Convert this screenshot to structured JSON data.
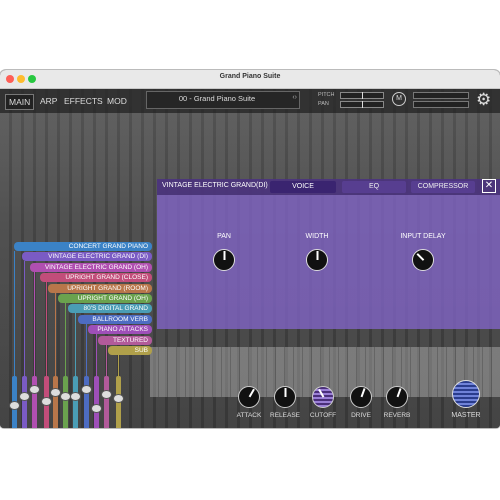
{
  "window": {
    "title": "Grand Piano Suite"
  },
  "tabs": [
    {
      "label": "MAIN",
      "active": true
    },
    {
      "label": "ARP",
      "active": false
    },
    {
      "label": "EFFECTS",
      "active": false
    },
    {
      "label": "MOD",
      "active": false
    }
  ],
  "preset": {
    "name": "00 - Grand Piano Suite",
    "arrow_icon": "chevron-left-right-icon"
  },
  "controls": {
    "pitch_label": "PITCH",
    "pan_label": "PAN",
    "midi_button": "M",
    "settings_icon": "gear-icon"
  },
  "panel": {
    "title": "VINTAGE ELECTRIC GRAND(DI)",
    "tabs": [
      {
        "label": "VOICE",
        "active": true
      },
      {
        "label": "EQ",
        "active": false
      },
      {
        "label": "COMPRESSOR",
        "active": false
      }
    ],
    "close_icon": "close-icon",
    "knobs": [
      {
        "label": "PAN",
        "value": 0.5
      },
      {
        "label": "WIDTH",
        "value": 0.5
      },
      {
        "label": "INPUT DELAY",
        "value": 0.15
      }
    ]
  },
  "layers": [
    {
      "name": "CONCERT GRAND PIANO",
      "color": "#3b82c6"
    },
    {
      "name": "VINTAGE ELECTRIC GRAND (DI)",
      "color": "#7a5bc4"
    },
    {
      "name": "VINTAGE ELECTRIC GRAND (OH)",
      "color": "#b04fb0"
    },
    {
      "name": "UPRIGHT GRAND (CLOSE)",
      "color": "#c24d7a"
    },
    {
      "name": "UPRIGHT GRAND (ROOM)",
      "color": "#b8764a"
    },
    {
      "name": "UPRIGHT GRAND (OH)",
      "color": "#6aa24e"
    },
    {
      "name": "80'S DIGITAL GRAND",
      "color": "#4a9db5"
    },
    {
      "name": "BALLROOM VERB",
      "color": "#4d6cc2"
    },
    {
      "name": "PIANO ATTACKS",
      "color": "#9e4fb8"
    },
    {
      "name": "TEXTURED",
      "color": "#b25a9a"
    },
    {
      "name": "SUB",
      "color": "#b0a04a"
    }
  ],
  "faders": [
    0.55,
    0.35,
    0.2,
    0.45,
    0.25,
    0.35,
    0.35,
    0.2,
    0.6,
    0.3,
    0.4
  ],
  "fx_knobs": [
    {
      "label": "ATTACK"
    },
    {
      "label": "RELEASE"
    },
    {
      "label": "CUTOFF"
    },
    {
      "label": "DRIVE"
    },
    {
      "label": "REVERB"
    }
  ],
  "master_label": "MASTER"
}
